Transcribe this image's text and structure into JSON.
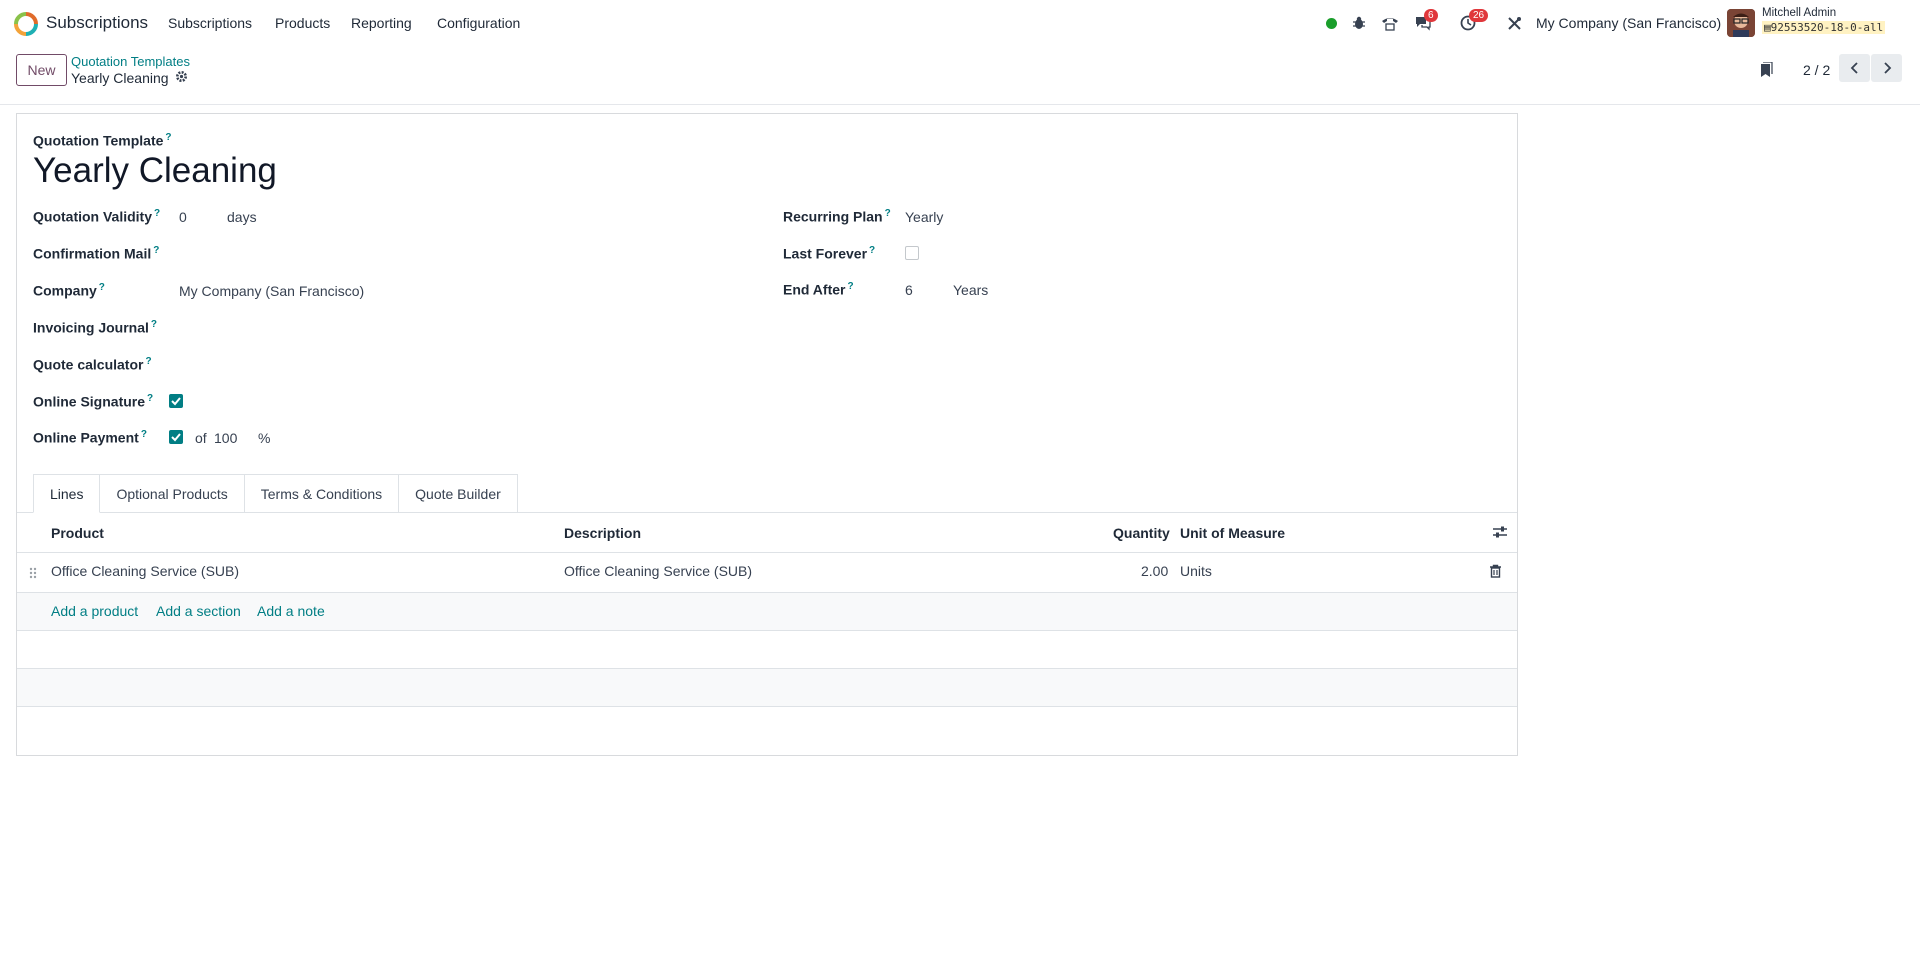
{
  "topnav": {
    "app_name": "Subscriptions",
    "menu": [
      "Subscriptions",
      "Products",
      "Reporting",
      "Configuration"
    ],
    "chat_badge": "6",
    "activity_badge": "26",
    "company": "My Company (San Francisco)",
    "user_name": "Mitchell Admin",
    "db_name": "92553520-18-0-all"
  },
  "control_panel": {
    "new_label": "New",
    "breadcrumb": "Quotation Templates",
    "record_name": "Yearly Cleaning",
    "pager": "2 / 2"
  },
  "form": {
    "title_label": "Quotation Template",
    "title_value": "Yearly Cleaning",
    "left_fields": {
      "validity_label": "Quotation Validity",
      "validity_value": "0",
      "validity_unit": "days",
      "confirmation_mail_label": "Confirmation Mail",
      "company_label": "Company",
      "company_value": "My Company (San Francisco)",
      "invoicing_journal_label": "Invoicing Journal",
      "quote_calculator_label": "Quote calculator",
      "online_signature_label": "Online Signature",
      "online_signature_checked": true,
      "online_payment_label": "Online Payment",
      "online_payment_checked": true,
      "online_payment_of": "of",
      "online_payment_value": "100",
      "online_payment_unit": "%"
    },
    "right_fields": {
      "recurring_plan_label": "Recurring Plan",
      "recurring_plan_value": "Yearly",
      "last_forever_label": "Last Forever",
      "last_forever_checked": false,
      "end_after_label": "End After",
      "end_after_value": "6",
      "end_after_unit": "Years"
    },
    "help_mark": "?"
  },
  "tabs": [
    "Lines",
    "Optional Products",
    "Terms & Conditions",
    "Quote Builder"
  ],
  "lines_table": {
    "headers": {
      "product": "Product",
      "description": "Description",
      "quantity": "Quantity",
      "uom": "Unit of Measure"
    },
    "rows": [
      {
        "product": "Office Cleaning Service (SUB)",
        "description": "Office Cleaning Service (SUB)",
        "quantity": "2.00",
        "uom": "Units"
      }
    ],
    "add_product": "Add a product",
    "add_section": "Add a section",
    "add_note": "Add a note"
  },
  "colors": {
    "accent": "#017e84",
    "brand": "#714b67",
    "badge": "#e0373b",
    "online_dot": "#1a9e2b"
  }
}
